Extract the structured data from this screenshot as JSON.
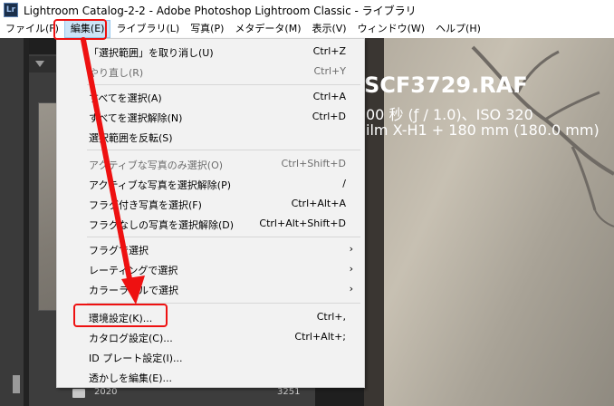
{
  "window": {
    "app_icon": "Lr",
    "title": "Lightroom Catalog-2-2 - Adobe Photoshop Lightroom Classic - ライブラリ"
  },
  "menubar": [
    {
      "label": "ファイル(F)",
      "active": false
    },
    {
      "label": "編集(E)",
      "active": true
    },
    {
      "label": "ライブラリ(L)",
      "active": false
    },
    {
      "label": "写真(P)",
      "active": false
    },
    {
      "label": "メタデータ(M)",
      "active": false
    },
    {
      "label": "表示(V)",
      "active": false
    },
    {
      "label": "ウィンドウ(W)",
      "active": false
    },
    {
      "label": "ヘルプ(H)",
      "active": false
    }
  ],
  "edit_menu": {
    "items": [
      {
        "label": "「選択範囲」を取り消し(U)",
        "shortcut": "Ctrl+Z",
        "enabled": true,
        "submenu": false
      },
      {
        "label": "やり直し(R)",
        "shortcut": "Ctrl+Y",
        "enabled": false,
        "submenu": false
      },
      {
        "label": "すべてを選択(A)",
        "shortcut": "Ctrl+A",
        "enabled": true,
        "submenu": false
      },
      {
        "label": "すべてを選択解除(N)",
        "shortcut": "Ctrl+D",
        "enabled": true,
        "submenu": false
      },
      {
        "label": "選択範囲を反転(S)",
        "shortcut": "",
        "enabled": true,
        "submenu": false
      },
      {
        "label": "アクティブな写真のみ選択(O)",
        "shortcut": "Ctrl+Shift+D",
        "enabled": false,
        "submenu": false
      },
      {
        "label": "アクティブな写真を選択解除(P)",
        "shortcut": "/",
        "enabled": true,
        "submenu": false
      },
      {
        "label": "フラグ付き写真を選択(F)",
        "shortcut": "Ctrl+Alt+A",
        "enabled": true,
        "submenu": false
      },
      {
        "label": "フラグなしの写真を選択解除(D)",
        "shortcut": "Ctrl+Alt+Shift+D",
        "enabled": true,
        "submenu": false
      },
      {
        "label": "フラグで選択",
        "shortcut": "",
        "enabled": true,
        "submenu": true
      },
      {
        "label": "レーティングで選択",
        "shortcut": "",
        "enabled": true,
        "submenu": true
      },
      {
        "label": "カラーラベルで選択",
        "shortcut": "",
        "enabled": true,
        "submenu": true
      },
      {
        "label": "環境設定(K)...",
        "shortcut": "Ctrl+,",
        "enabled": true,
        "submenu": false
      },
      {
        "label": "カタログ設定(C)...",
        "shortcut": "Ctrl+Alt+;",
        "enabled": true,
        "submenu": false
      },
      {
        "label": "ID プレート設定(I)...",
        "shortcut": "",
        "enabled": true,
        "submenu": false
      },
      {
        "label": "透かしを編集(E)...",
        "shortcut": "",
        "enabled": true,
        "submenu": false
      }
    ],
    "submenu_arrow": "›"
  },
  "photo_overlay": {
    "filename": "SCF3729.RAF",
    "exposure": "00 秒 (ƒ / 1.0)、ISO 320",
    "camera": "ilm X-H1 + 180 mm (180.0 mm)"
  },
  "folder": {
    "name": "2020",
    "count": "3251"
  },
  "annotation": {
    "color": "#e11111"
  }
}
